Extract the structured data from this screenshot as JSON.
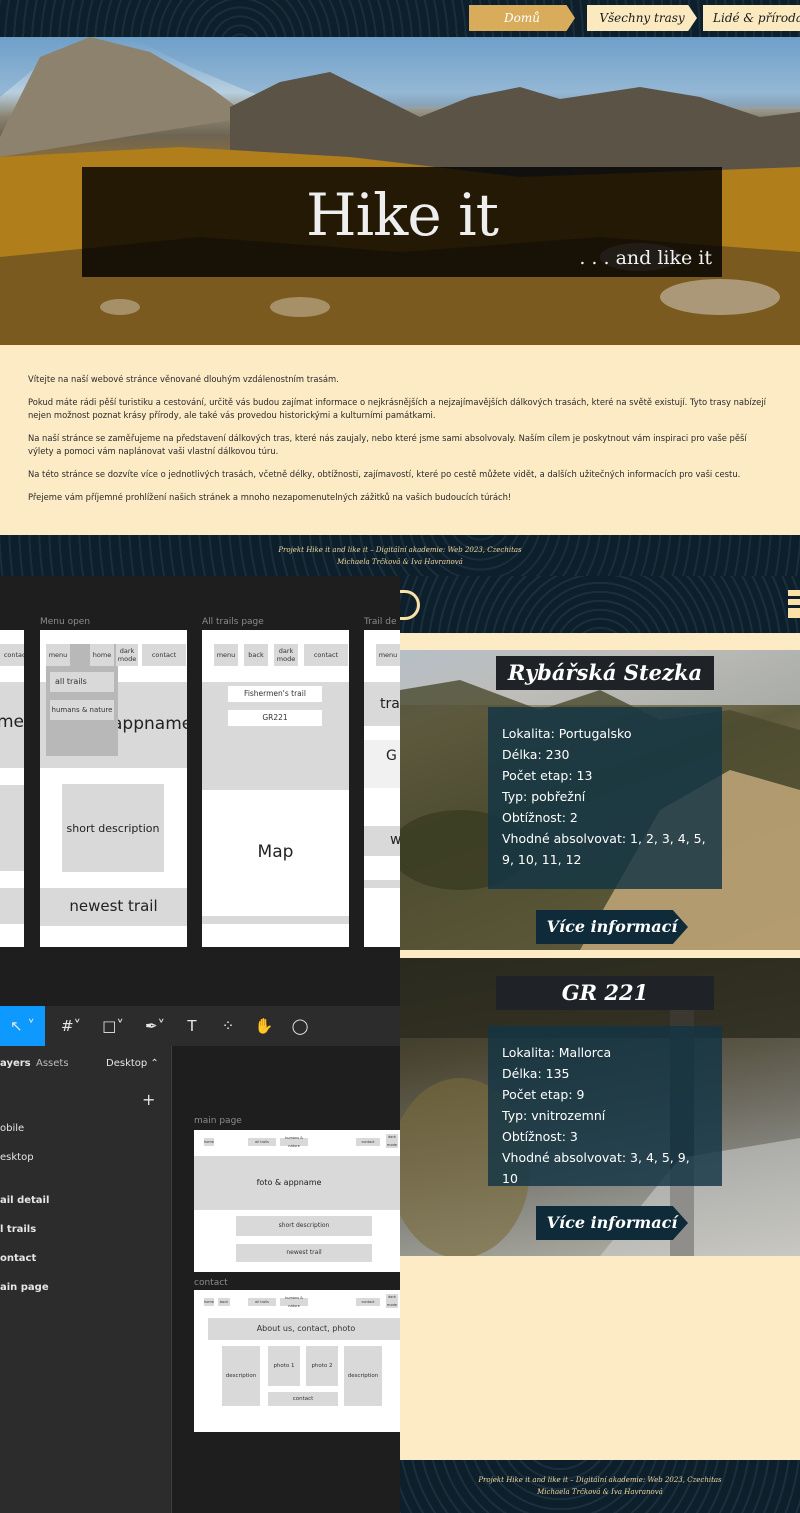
{
  "site": {
    "nav": [
      "Domů",
      "Všechny trasy",
      "Lidé & příroda"
    ],
    "hero_title": "Hike it",
    "hero_subtitle": ". . . and like it",
    "intro": [
      "Vítejte na naší webové stránce věnované dlouhým vzdálenostním trasám.",
      "Pokud máte rádi pěší turistiku a cestování, určitě vás budou zajímat informace o nejkrásnějších a nejzajímavějších dálkových trasách, které na světě existují. Tyto trasy nabízejí nejen možnost poznat krásy přírody, ale také vás provedou historickými a kulturními památkami.",
      "Na naší stránce se zaměřujeme na představení dálkových tras, které nás zaujaly, nebo které jsme sami absolvovaly. Naším cílem je poskytnout vám inspiraci pro vaše pěší výlety a pomoci vám naplánovat vaši vlastní dálkovou túru.",
      "Na této stránce se dozvíte více o jednotlivých trasách, včetně délky, obtížnosti, zajímavostí, které po cestě můžete vidět, a dalších užitečných informacích pro vaši cestu.",
      "Přejeme vám příjemné prohlížení našich stránek a mnoho nezapomenutelných zážitků na vašich budoucích túrách!"
    ],
    "footer_line1": "Projekt Hike it and like it – Digitální akademie: Web 2023, Czechitas",
    "footer_line2": "Michaela Trčková & Iva Havranová"
  },
  "figma": {
    "frame_labels": [
      "Menu open",
      "All trails page",
      "Trail de"
    ],
    "frame1": {
      "buttons": [
        "contact"
      ],
      "big_text": "me"
    },
    "frame2": {
      "buttons": [
        "menu",
        "home",
        "dark mode",
        "contact"
      ],
      "menu_items": [
        "all trails",
        "humans & nature"
      ],
      "appname": "appname",
      "short": "short description",
      "newest": "newest trail"
    },
    "frame3": {
      "buttons": [
        "menu",
        "back",
        "dark mode",
        "contact"
      ],
      "trails": [
        "Fishermen's trail",
        "GR221"
      ],
      "map": "Map"
    },
    "frame4": {
      "buttons": [
        "menu"
      ],
      "texts": [
        "tra",
        "G",
        "w"
      ]
    },
    "tabs": [
      "ayers",
      "Assets",
      "Desktop ⌃"
    ],
    "pages": [
      "obile",
      "esktop"
    ],
    "layers": [
      "ail detail",
      "l trails",
      "ontact",
      "ain page"
    ],
    "main_label": "main page",
    "main_frame": {
      "buttons": [
        "home",
        "all trails",
        "humans & nature",
        "contact",
        "dark mode"
      ],
      "hero": "foto & appname",
      "short": "short description",
      "newest": "newest trail"
    },
    "contact_label": "contact",
    "contact_frame": {
      "buttons": [
        "home",
        "back",
        "all trails",
        "humans & nature",
        "contact",
        "dark mode"
      ],
      "header": "About us, contact, photo",
      "boxes": [
        "description",
        "photo 1",
        "photo 2",
        "description",
        "contact"
      ]
    }
  },
  "trails": [
    {
      "name": "Rybářská Stezka",
      "info": [
        "Lokalita: Portugalsko",
        "Délka: 230",
        "Počet etap: 13",
        "Typ: pobřežní",
        "Obtížnost: 2",
        "Vhodné absolvovat: 1, 2, 3, 4, 5, 9, 10, 11, 12"
      ],
      "button": "Více informací"
    },
    {
      "name": "GR 221",
      "info": [
        "Lokalita: Mallorca",
        "Délka: 135",
        "Počet etap: 9",
        "Typ: vnitrozemní",
        "Obtížnost: 3",
        "Vhodné absolvovat: 3, 4, 5, 9, 10"
      ],
      "button": "Více informací"
    }
  ],
  "colors": {
    "navy": "#0d1f2b",
    "cream": "#fdebc5",
    "gold": "#d9ac5c",
    "teal_panel": "#12344480"
  }
}
